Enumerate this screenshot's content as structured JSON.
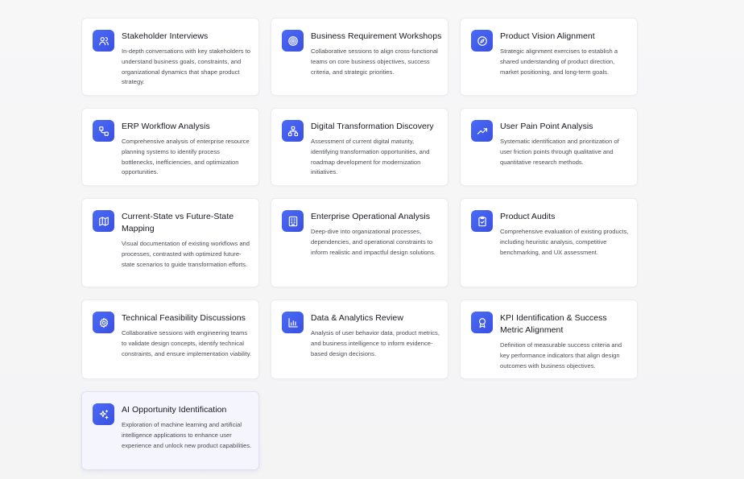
{
  "cards": [
    {
      "title": "Stakeholder Interviews",
      "icon": "users-icon",
      "description": "In-depth conversations with key stakeholders to understand business goals, constraints, and organizational dynamics that shape product strategy."
    },
    {
      "title": "Business Requirement Workshops",
      "icon": "target-icon",
      "description": "Collaborative sessions to align cross-functional teams on core business objectives, success criteria, and strategic priorities."
    },
    {
      "title": "Product Vision Alignment",
      "icon": "compass-icon",
      "description": "Strategic alignment exercises to establish a shared understanding of product direction, market positioning, and long-term goals."
    },
    {
      "title": "ERP Workflow Analysis",
      "icon": "workflow-icon",
      "description": "Comprehensive analysis of enterprise resource planning systems to identify process bottlenecks, inefficiencies, and optimization opportunities."
    },
    {
      "title": "Digital Transformation Discovery",
      "icon": "network-icon",
      "description": "Assessment of current digital maturity, identifying transformation opportunities, and roadmap development for modernization initiatives."
    },
    {
      "title": "User Pain Point Analysis",
      "icon": "trending-up-icon",
      "description": "Systematic identification and prioritization of user friction points through qualitative and quantitative research methods."
    },
    {
      "title": "Current-State vs Future-State Mapping",
      "icon": "map-icon",
      "description": "Visual documentation of existing workflows and processes, contrasted with optimized future-state scenarios to guide transformation efforts."
    },
    {
      "title": "Enterprise Operational Analysis",
      "icon": "building-icon",
      "description": "Deep-dive into organizational processes, dependencies, and operational constraints to inform realistic and impactful design solutions."
    },
    {
      "title": "Product Audits",
      "icon": "clipboard-check-icon",
      "description": "Comprehensive evaluation of existing products, including heuristic analysis, competitive benchmarking, and UX assessment."
    },
    {
      "title": "Technical Feasibility Discussions",
      "icon": "gear-icon",
      "description": "Collaborative sessions with engineering teams to validate design concepts, identify technical constraints, and ensure implementation viability."
    },
    {
      "title": "Data & Analytics Review",
      "icon": "bar-chart-icon",
      "description": "Analysis of user behavior data, product metrics, and business intelligence to inform evidence-based design decisions."
    },
    {
      "title": "KPI Identification & Success Metric Alignment",
      "icon": "award-icon",
      "description": "Definition of measurable success criteria and key performance indicators that align design outcomes with business objectives."
    },
    {
      "title": "AI Opportunity Identification",
      "icon": "sparkles-icon",
      "description": "Exploration of machine learning and artificial intelligence applications to enhance user experience and unlock new product capabilities."
    }
  ],
  "colors": {
    "icon_gradient_start": "#4a6cf7",
    "icon_gradient_end": "#3a4fe0",
    "title": "#15171c",
    "description": "#4a4d55",
    "card_bg": "#ffffff",
    "highlight_bg": "#f4f5fd"
  }
}
